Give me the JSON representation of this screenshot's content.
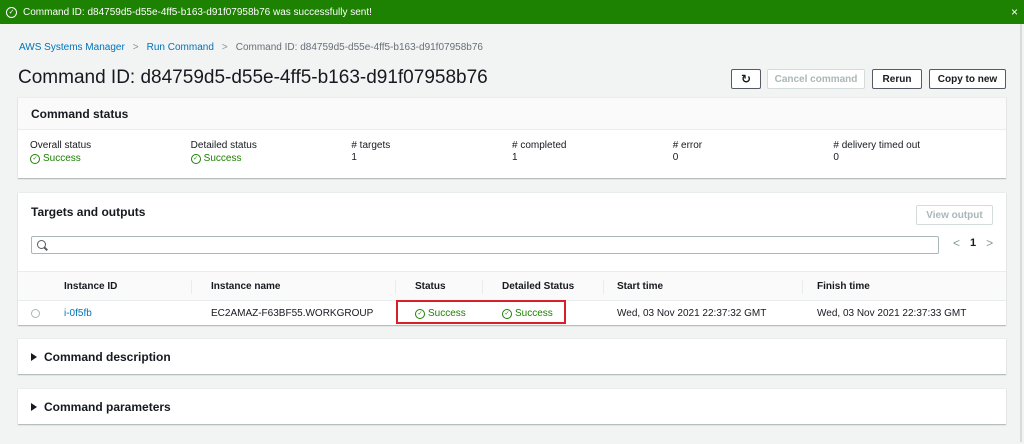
{
  "banner": {
    "message": "Command ID: d84759d5-d55e-4ff5-b163-d91f07958b76 was successfully sent!",
    "close": "×"
  },
  "breadcrumb": {
    "items": [
      "AWS Systems Manager",
      "Run Command",
      "Command ID: d84759d5-d55e-4ff5-b163-d91f07958b76"
    ],
    "separator": ">"
  },
  "page": {
    "title": "Command ID: d84759d5-d55e-4ff5-b163-d91f07958b76"
  },
  "actions": {
    "refresh_icon": "↻",
    "cancel": "Cancel command",
    "rerun": "Rerun",
    "copy": "Copy to new"
  },
  "command_status": {
    "heading": "Command status",
    "fields": [
      {
        "label": "Overall status",
        "value": "Success",
        "success": true
      },
      {
        "label": "Detailed status",
        "value": "Success",
        "success": true
      },
      {
        "label": "# targets",
        "value": "1"
      },
      {
        "label": "# completed",
        "value": "1"
      },
      {
        "label": "# error",
        "value": "0"
      },
      {
        "label": "# delivery timed out",
        "value": "0"
      }
    ]
  },
  "targets": {
    "heading": "Targets and outputs",
    "view_output": "View output",
    "search_placeholder": "",
    "pager": {
      "prev": "<",
      "page": "1",
      "next": ">"
    },
    "columns": [
      "Instance ID",
      "Instance name",
      "Status",
      "Detailed Status",
      "Start time",
      "Finish time"
    ],
    "rows": [
      {
        "instance_id": "i-0f5fb",
        "instance_name": "EC2AMAZ-F63BF55.WORKGROUP",
        "status": "Success",
        "detailed_status": "Success",
        "start_time": "Wed, 03 Nov 2021 22:37:32 GMT",
        "finish_time": "Wed, 03 Nov 2021 22:37:33 GMT"
      }
    ]
  },
  "sections": {
    "description": "Command description",
    "parameters": "Command parameters"
  },
  "icons": {
    "check": "✓"
  },
  "colors": {
    "success": "#1d8102",
    "link": "#0073bb",
    "highlight": "#d9202a"
  }
}
